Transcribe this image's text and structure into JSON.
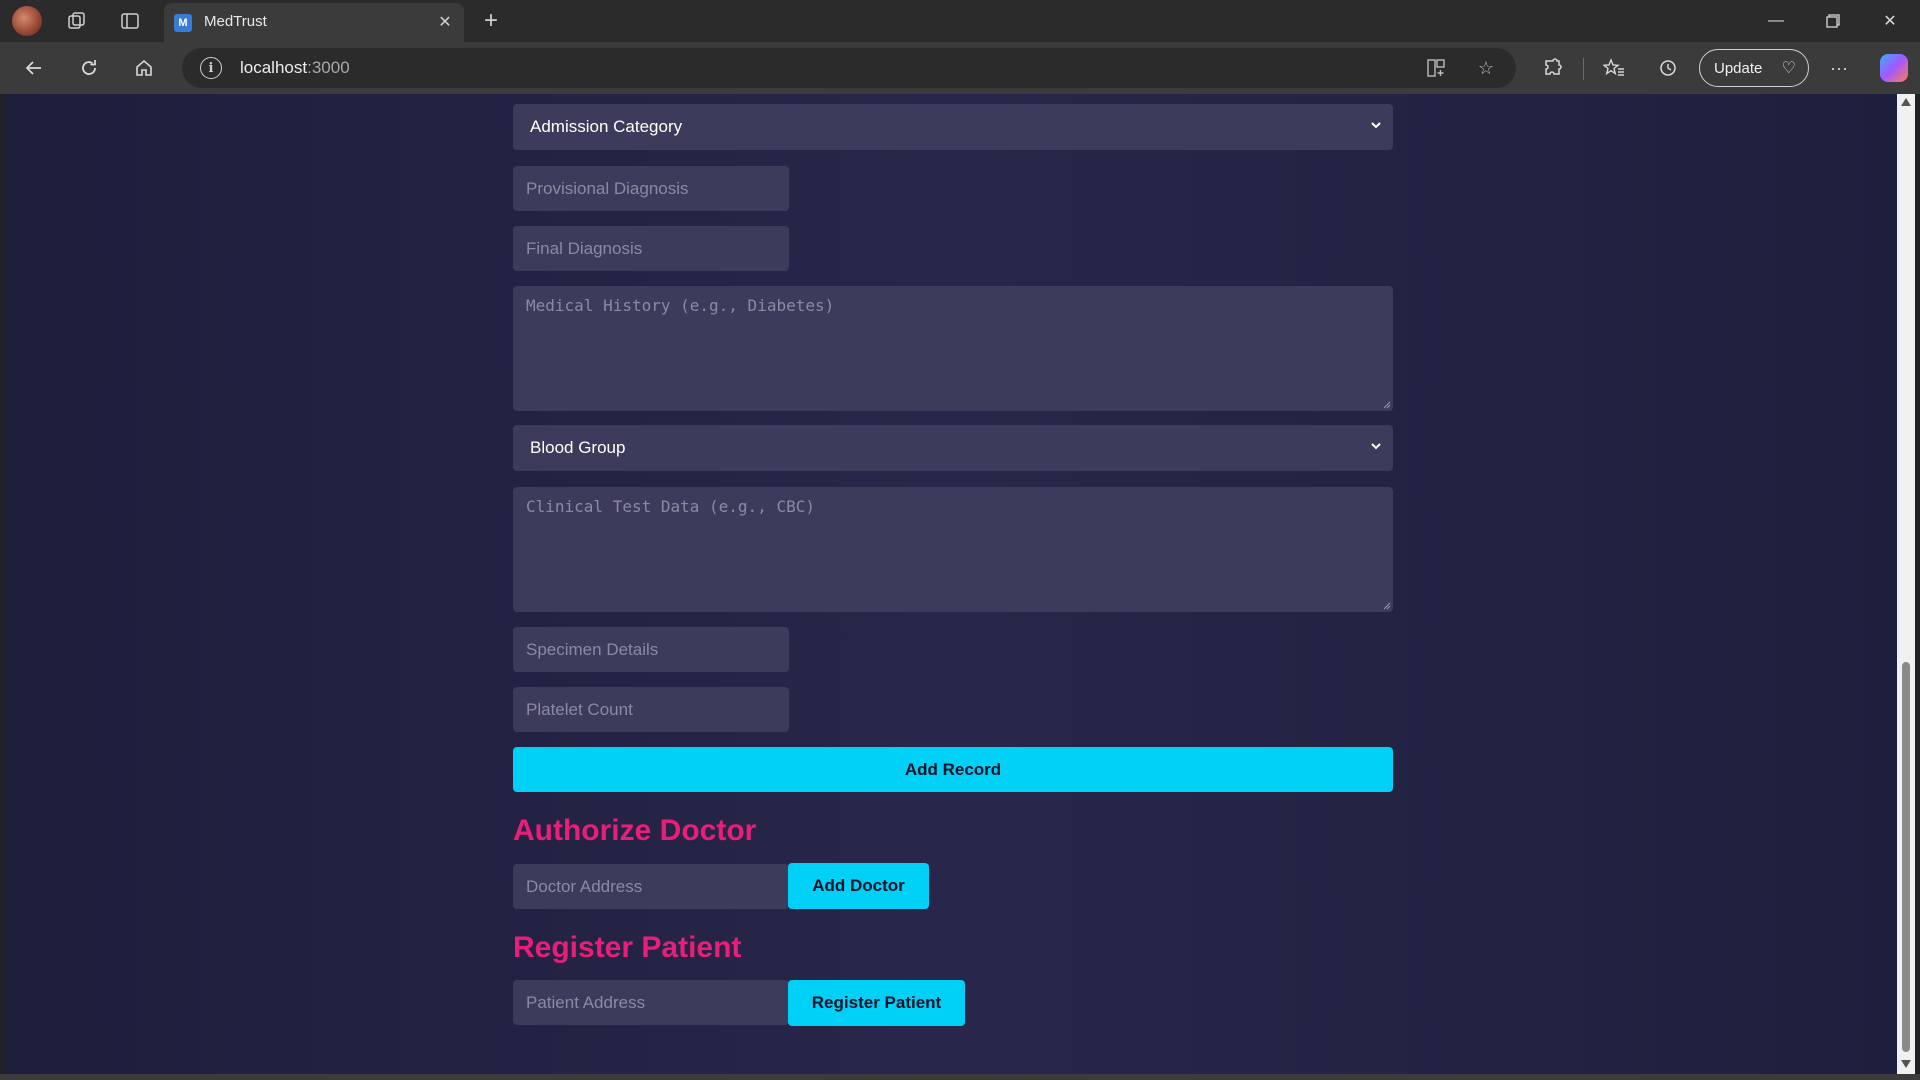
{
  "browser": {
    "tab_title": "MedTrust",
    "tab_favicon": "M",
    "url_host": "localhost",
    "url_port": ":3000",
    "update_label": "Update",
    "more_label": "···"
  },
  "form": {
    "admission_category": "Admission Category",
    "provisional_diagnosis_placeholder": "Provisional Diagnosis",
    "final_diagnosis_placeholder": "Final Diagnosis",
    "medical_history_placeholder": "Medical History (e.g., Diabetes)",
    "blood_group": "Blood Group",
    "clinical_test_placeholder": "Clinical Test Data (e.g., CBC)",
    "specimen_details_placeholder": "Specimen Details",
    "platelet_count_placeholder": "Platelet Count",
    "add_record_label": "Add Record"
  },
  "authorize_doctor": {
    "title": "Authorize Doctor",
    "address_placeholder": "Doctor Address",
    "button_label": "Add Doctor"
  },
  "register_patient": {
    "title": "Register Patient",
    "address_placeholder": "Patient Address",
    "button_label": "Register Patient"
  },
  "colors": {
    "accent": "#00d0f5",
    "heading": "#e91e78",
    "field_bg": "#3d3b5c",
    "page_bg": "#25244a"
  },
  "icons": [
    "profile-avatar-icon",
    "workspaces-icon",
    "tab-actions-icon",
    "close-icon",
    "new-tab-icon",
    "minimize-icon",
    "restore-icon",
    "window-close-icon",
    "back-icon",
    "refresh-icon",
    "home-icon",
    "site-info-icon",
    "split-screen-icon",
    "favorite-star-icon",
    "extensions-icon",
    "favorites-icon",
    "history-icon",
    "heart-icon",
    "more-icon",
    "copilot-icon",
    "chevron-down-icon"
  ]
}
